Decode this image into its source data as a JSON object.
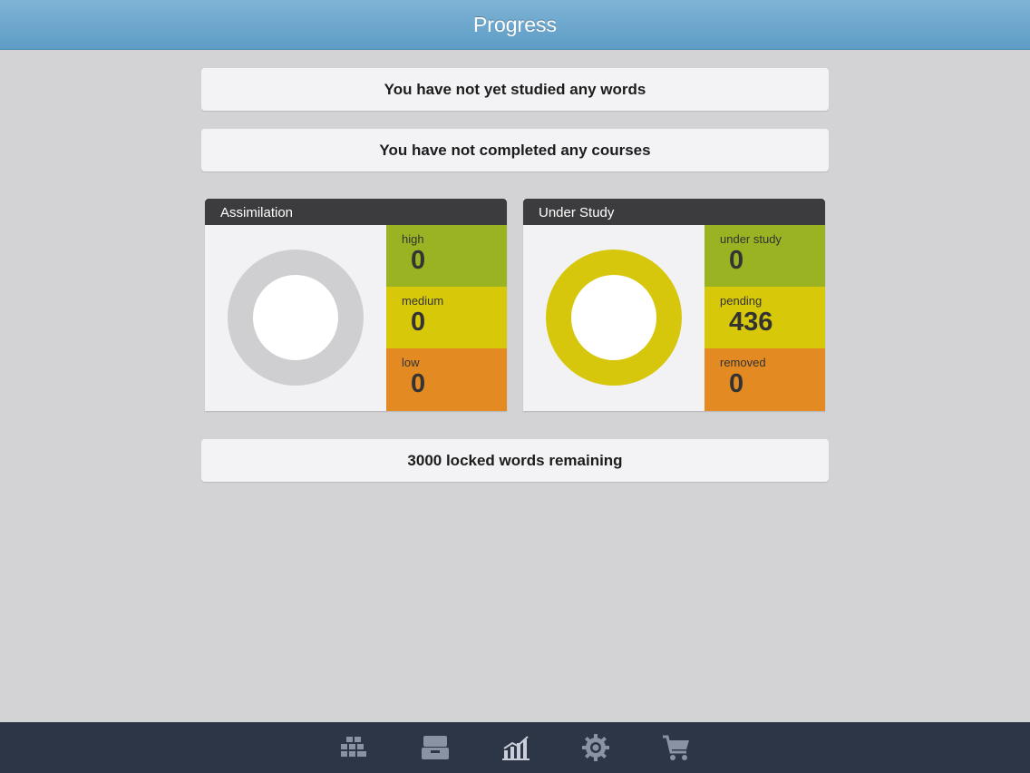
{
  "header": {
    "title": "Progress"
  },
  "banners": {
    "words": "You have not yet studied any words",
    "courses": "You have not completed any courses",
    "locked": "3000 locked words remaining"
  },
  "assimilation": {
    "title": "Assimilation",
    "stats": [
      {
        "label": "high",
        "value": "0",
        "color": "#99b322"
      },
      {
        "label": "medium",
        "value": "0",
        "color": "#d8c80a"
      },
      {
        "label": "low",
        "value": "0",
        "color": "#e38a22"
      }
    ],
    "donut_color": "#cfcfd1"
  },
  "under_study": {
    "title": "Under Study",
    "stats": [
      {
        "label": "under study",
        "value": "0",
        "color": "#99b322"
      },
      {
        "label": "pending",
        "value": "436",
        "color": "#d8c80a"
      },
      {
        "label": "removed",
        "value": "0",
        "color": "#e38a22"
      }
    ],
    "donut_color": "#d6c70d"
  },
  "tabbar": {
    "items": [
      {
        "icon": "grid-icon",
        "active": false
      },
      {
        "icon": "inbox-icon",
        "active": false
      },
      {
        "icon": "chart-icon",
        "active": true
      },
      {
        "icon": "gear-icon",
        "active": false
      },
      {
        "icon": "cart-icon",
        "active": false
      }
    ]
  }
}
